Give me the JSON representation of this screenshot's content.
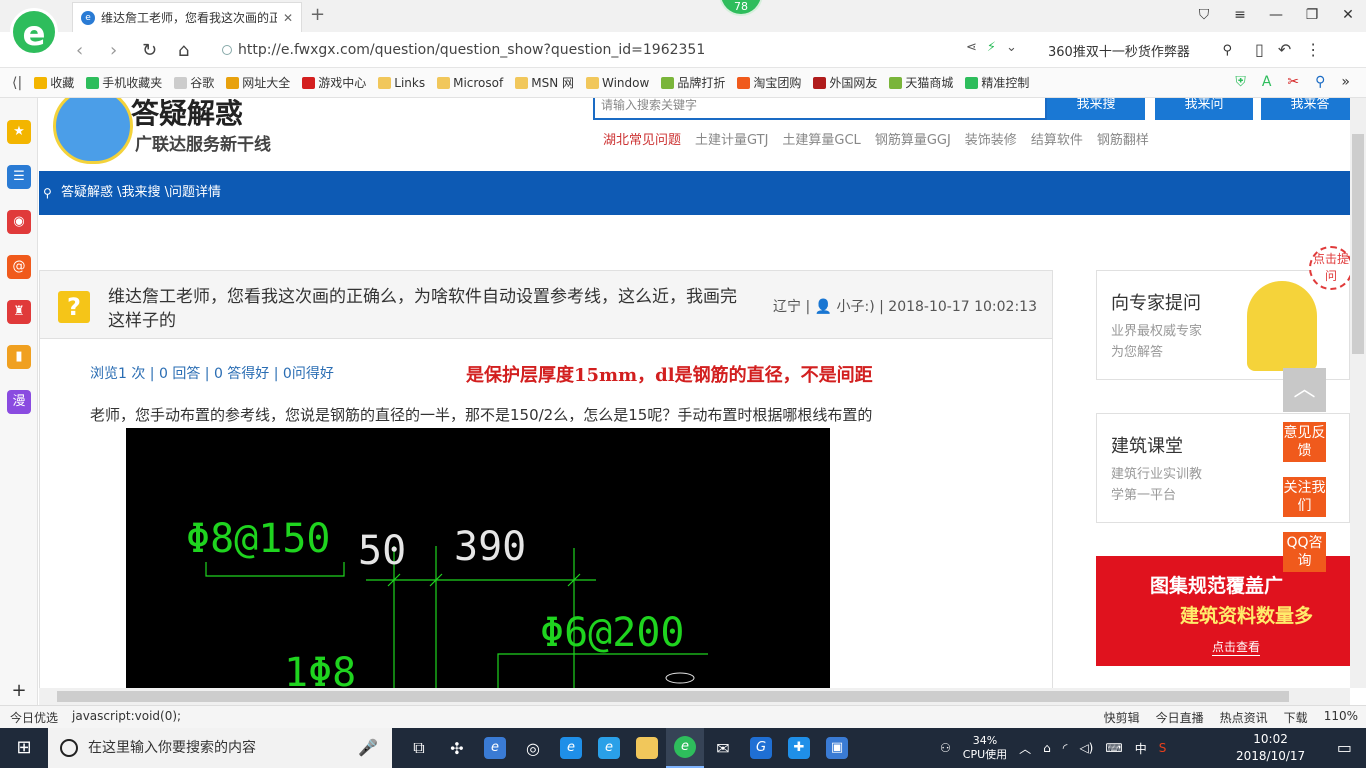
{
  "browser": {
    "tab_title": "维达詹工老师，您看我这次画的正",
    "tab_close": "✕",
    "badge": "78",
    "url": "http://e.fwxgx.com/question/question_show?question_id=1962351",
    "search_text": "360推双十一秒货作弊器",
    "logo_glyph": "e"
  },
  "bookmarks": [
    {
      "label": "收藏",
      "icon": "star-icon",
      "color": "#f3b500"
    },
    {
      "label": "手机收藏夹",
      "icon": "phone-icon",
      "color": "#2ebd5c"
    },
    {
      "label": "谷歌",
      "icon": "page-icon",
      "color": "#cccccc"
    },
    {
      "label": "网址大全",
      "icon": "globe-icon",
      "color": "#e8a10d"
    },
    {
      "label": "游戏中心",
      "icon": "game-icon",
      "color": "#d41f1f"
    },
    {
      "label": "Links",
      "icon": "folder-icon",
      "color": "#f1c75b"
    },
    {
      "label": "Microsof",
      "icon": "folder-icon",
      "color": "#f1c75b"
    },
    {
      "label": "MSN 网",
      "icon": "folder-icon",
      "color": "#f1c75b"
    },
    {
      "label": "Window",
      "icon": "folder-icon",
      "color": "#f1c75b"
    },
    {
      "label": "品牌打折",
      "icon": "leaf-icon",
      "color": "#7ab53a"
    },
    {
      "label": "淘宝团购",
      "icon": "taobao-icon",
      "color": "#f05a1c"
    },
    {
      "label": "外国网友",
      "icon": "flag-icon",
      "color": "#b01c1c"
    },
    {
      "label": "天猫商城",
      "icon": "leaf-icon",
      "color": "#7ab53a"
    },
    {
      "label": "精准控制",
      "icon": "wechat-icon",
      "color": "#2ebd5c"
    }
  ],
  "site": {
    "title": "答疑解惑",
    "subtitle": "广联达服务新干线",
    "search_placeholder": "请输入搜索关键字",
    "buttons": [
      "我来搜",
      "我来问",
      "我来答"
    ],
    "hot_links": [
      "湖北常见问题",
      "土建计量GTJ",
      "土建算量GCL",
      "钢筋算量GGJ",
      "装饰装修",
      "结算软件",
      "钢筋翻样"
    ],
    "breadcrumb": "答疑解惑 \\我来搜 \\问题详情"
  },
  "question": {
    "icon": "?",
    "title": "维达詹工老师，您看我这次画的正确么，为啥软件自动设置参考线，这么近，我画完这样子的",
    "meta": "辽宁 | 👤 小子:) | 2018-10-17 10:02:13",
    "stats": "浏览1 次 | 0 回答 | 0 答得好 | 0问得好",
    "answer_note": "是保护层厚度15mm，dl是钢筋的直径，不是间距",
    "body": "老师，您手动布置的参考线，您说是钢筋的直径的一半，那不是150/2么，怎么是15呢？手动布置时根据哪根线布置的"
  },
  "cad": {
    "labels": [
      "Φ8@150",
      "50",
      "390",
      "Φ6@200",
      "1Φ8"
    ],
    "line_color": "#1fd41f",
    "text_color": "#e6e6e6"
  },
  "sidebar": {
    "expert": {
      "title": "向专家提问",
      "line1": "业界最权威专家",
      "line2": "为您解答"
    },
    "course": {
      "title": "建筑课堂",
      "line1": "建筑行业实训教",
      "line2": "学第一平台"
    },
    "banner": {
      "line1": "图集规范覆盖广",
      "line2": "建筑资料数量多",
      "cta": "点击查看"
    },
    "ask_tag": "点击提问",
    "float_buttons": [
      "意见反馈",
      "关注我们",
      "QQ咨询"
    ],
    "to_top": "︿"
  },
  "status_bar": {
    "left": [
      "今日优选",
      "javascript:void(0);"
    ],
    "right": [
      "快剪辑",
      "今日直播",
      "热点资讯",
      "下载",
      "110%"
    ]
  },
  "taskbar": {
    "search_placeholder": "在这里输入你要搜索的内容",
    "cpu_percent": "34%",
    "cpu_label": "CPU使用",
    "ime": "中",
    "time": "10:02",
    "date": "2018/10/17"
  }
}
